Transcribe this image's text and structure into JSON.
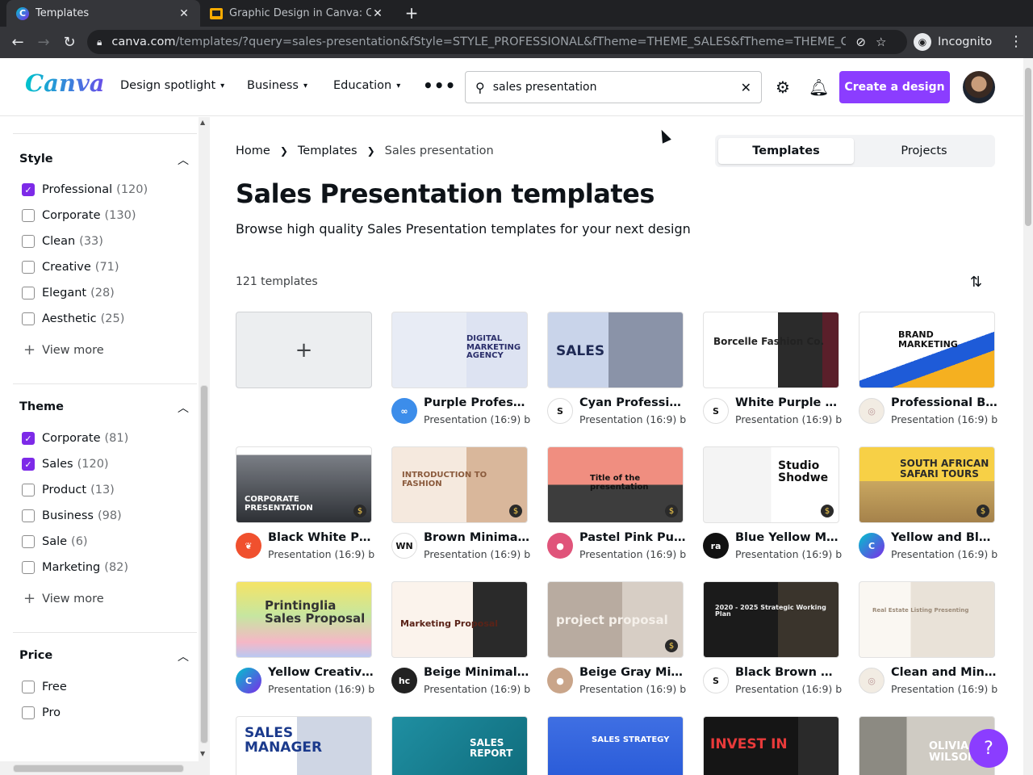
{
  "browser": {
    "tabs": [
      {
        "title": "Templates",
        "active": true,
        "icon": "canva-favicon"
      },
      {
        "title": "Graphic Design in Canva: C",
        "active": false,
        "icon": "slides-favicon"
      }
    ],
    "new_tab_label": "+",
    "url_host": "canva.com",
    "url_path": "/templates/?query=sales-presentation&fStyle=STYLE_PROFESSIONAL&fTheme=THEME_SALES&fTheme=THEME_C...",
    "incognito_label": "Incognito"
  },
  "header": {
    "logo": "Canva",
    "nav": [
      {
        "label": "Design spotlight"
      },
      {
        "label": "Business"
      },
      {
        "label": "Education"
      }
    ],
    "search_value": "sales presentation",
    "create_label": "Create a design"
  },
  "sidebar": {
    "style": {
      "title": "Style",
      "options": [
        {
          "label": "Professional",
          "count": "(120)",
          "checked": true
        },
        {
          "label": "Corporate",
          "count": "(130)",
          "checked": false
        },
        {
          "label": "Clean",
          "count": "(33)",
          "checked": false
        },
        {
          "label": "Creative",
          "count": "(71)",
          "checked": false
        },
        {
          "label": "Elegant",
          "count": "(28)",
          "checked": false
        },
        {
          "label": "Aesthetic",
          "count": "(25)",
          "checked": false
        }
      ],
      "view_more": "View more"
    },
    "theme": {
      "title": "Theme",
      "options": [
        {
          "label": "Corporate",
          "count": "(81)",
          "checked": true
        },
        {
          "label": "Sales",
          "count": "(120)",
          "checked": true
        },
        {
          "label": "Product",
          "count": "(13)",
          "checked": false
        },
        {
          "label": "Business",
          "count": "(98)",
          "checked": false
        },
        {
          "label": "Sale",
          "count": "(6)",
          "checked": false
        },
        {
          "label": "Marketing",
          "count": "(82)",
          "checked": false
        }
      ],
      "view_more": "View more"
    },
    "price": {
      "title": "Price",
      "options": [
        {
          "label": "Free",
          "checked": false
        },
        {
          "label": "Pro",
          "checked": false
        }
      ]
    }
  },
  "main": {
    "breadcrumbs": [
      "Home",
      "Templates",
      "Sales presentation"
    ],
    "toggle": {
      "templates": "Templates",
      "projects": "Projects"
    },
    "title": "Sales Presentation templates",
    "subtitle": "Browse high quality Sales Presentation templates for your next design",
    "count": "121 templates",
    "cards": [
      {
        "name": "Purple Professio...",
        "sub": "Presentation (16:9) b...",
        "thumb_text": "DIGITAL MARKETING AGENCY",
        "pro": false
      },
      {
        "name": "Cyan Professiona...",
        "sub": "Presentation (16:9) b...",
        "thumb_text": "SALES",
        "pro": false
      },
      {
        "name": "White Purple Pro...",
        "sub": "Presentation (16:9) b...",
        "thumb_text": "Borcelle Fashion Co.",
        "pro": false
      },
      {
        "name": "Professional Bra...",
        "sub": "Presentation (16:9) b...",
        "thumb_text": "BRAND MARKETING",
        "pro": false
      },
      {
        "name": "Black White Prof...",
        "sub": "Presentation (16:9) b...",
        "thumb_text": "CORPORATE PRESENTATION",
        "pro": true
      },
      {
        "name": "Brown Minimalis...",
        "sub": "Presentation (16:9) b...",
        "thumb_text": "INTRODUCTION TO FASHION",
        "pro": true
      },
      {
        "name": "Pastel Pink Purpl...",
        "sub": "Presentation (16:9) b...",
        "thumb_text": "Title of the presentation",
        "pro": true
      },
      {
        "name": "Blue Yellow Mini...",
        "sub": "Presentation (16:9) b...",
        "thumb_text": "Studio Shodwe",
        "pro": true
      },
      {
        "name": "Yellow and Black ...",
        "sub": "Presentation (16:9) b...",
        "thumb_text": "SOUTH AFRICAN SAFARI TOURS",
        "pro": true
      },
      {
        "name": "Yellow Creative ...",
        "sub": "Presentation (16:9) b...",
        "thumb_text": "Printinglia Sales Proposal",
        "pro": false
      },
      {
        "name": "Beige Minimalist ...",
        "sub": "Presentation (16:9) b...",
        "thumb_text": "Marketing Proposal",
        "pro": false
      },
      {
        "name": "Beige Gray Mini...",
        "sub": "Presentation (16:9) b...",
        "thumb_text": "project proposal",
        "pro": true
      },
      {
        "name": "Black Brown Mini...",
        "sub": "Presentation (16:9) b...",
        "thumb_text": "2020 - 2025 Strategic Working Plan",
        "pro": false
      },
      {
        "name": "Clean and Minim...",
        "sub": "Presentation (16:9) b...",
        "thumb_text": "Real Estate Listing Presenting",
        "pro": false
      },
      {
        "name": "",
        "sub": "",
        "thumb_text": "SALES MANAGER",
        "pro": false
      },
      {
        "name": "",
        "sub": "",
        "thumb_text": "SALES REPORT",
        "pro": false
      },
      {
        "name": "",
        "sub": "",
        "thumb_text": "SALES STRATEGY",
        "pro": false
      },
      {
        "name": "",
        "sub": "",
        "thumb_text": "INVEST IN",
        "pro": false
      },
      {
        "name": "",
        "sub": "",
        "thumb_text": "OLIVIA WILSON",
        "pro": false
      }
    ]
  },
  "help_label": "?",
  "colors": {
    "accent": "#8b3dff",
    "checkbox": "#7d2ae8",
    "brand": "#00c4cc"
  }
}
